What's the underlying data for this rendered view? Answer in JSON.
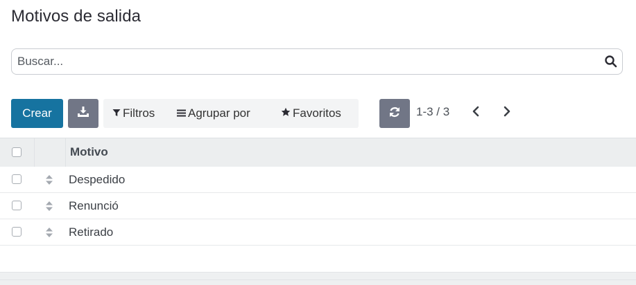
{
  "page": {
    "title": "Motivos de salida"
  },
  "search": {
    "placeholder": "Buscar..."
  },
  "toolbar": {
    "create_label": "Crear",
    "filters_label": "Filtros",
    "group_by_label": "Agrupar por",
    "favorites_label": "Favoritos"
  },
  "pager": {
    "value": "1-3 / 3"
  },
  "table": {
    "header": "Motivo",
    "rows": [
      {
        "name": "Despedido"
      },
      {
        "name": "Renunció"
      },
      {
        "name": "Retirado"
      }
    ]
  },
  "colors": {
    "primary": "#1673a0",
    "secondary": "#717686"
  },
  "icons": [
    "search-icon",
    "download-icon",
    "filter-icon",
    "list-icon",
    "star-icon",
    "refresh-icon",
    "chevron-left-icon",
    "chevron-right-icon",
    "drag-handle-icon"
  ]
}
